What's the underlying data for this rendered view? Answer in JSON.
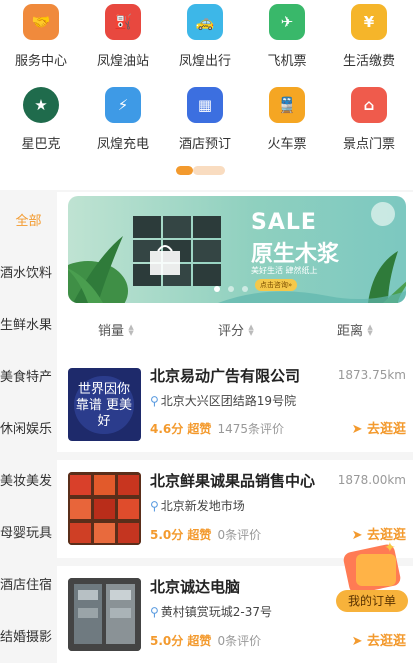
{
  "services": [
    {
      "label": "服务中心",
      "icon": "handshake-icon",
      "glyph": "🤝",
      "color": "#f08a3c"
    },
    {
      "label": "凤煌油站",
      "icon": "fuel-pump-icon",
      "glyph": "⛽",
      "color": "#e8483f"
    },
    {
      "label": "凤煌出行",
      "icon": "taxi-icon",
      "glyph": "🚕",
      "color": "#3db7e8"
    },
    {
      "label": "飞机票",
      "icon": "airplane-icon",
      "glyph": "✈",
      "color": "#39b86a"
    },
    {
      "label": "生活缴费",
      "icon": "coin-icon",
      "glyph": "¥",
      "color": "#f5b52a"
    },
    {
      "label": "星巴克",
      "icon": "starbucks-icon",
      "glyph": "★",
      "color": "#1f6b4c"
    },
    {
      "label": "凤煌充电",
      "icon": "charger-icon",
      "glyph": "⚡",
      "color": "#3e9ae6"
    },
    {
      "label": "酒店预订",
      "icon": "hotel-icon",
      "glyph": "▦",
      "color": "#3c6fe0"
    },
    {
      "label": "火车票",
      "icon": "train-icon",
      "glyph": "🚆",
      "color": "#f5a623"
    },
    {
      "label": "景点门票",
      "icon": "attraction-icon",
      "glyph": "⌂",
      "color": "#ef5b4c"
    }
  ],
  "sidebar": {
    "items": [
      "全部",
      "酒水饮料",
      "生鲜水果",
      "美食特产",
      "休闲娱乐",
      "美妆美发",
      "母婴玩具",
      "酒店住宿",
      "结婚摄影"
    ]
  },
  "banner": {
    "sale": "SALE",
    "title": "原生木浆",
    "tags": "美好生活  肆然纸上",
    "button": "点击咨询»"
  },
  "sort": {
    "sales": "销量",
    "rating": "评分",
    "distance": "距离"
  },
  "shops": [
    {
      "name": "北京易动广告有限公司",
      "distance": "1873.75km",
      "address": "北京大兴区团结路19号院",
      "score": "4.6分 超赞",
      "reviews": "1475条评价",
      "action": "去逛逛",
      "thumb_text": "世界因你 靠谱 更美好"
    },
    {
      "name": "北京鲜果诚果品销售中心",
      "distance": "1878.00km",
      "address": "北京新发地市场",
      "score": "5.0分 超赞",
      "reviews": "0条评价",
      "action": "去逛逛"
    },
    {
      "name": "北京诚达电脑",
      "distance": "",
      "address": "黄村镇赏玩城2-37号",
      "score": "5.0分 超赞",
      "reviews": "0条评价",
      "action": "去逛逛"
    }
  ],
  "floating": {
    "orders_label": "我的订单"
  },
  "colors": {
    "accent": "#f39a2e",
    "pin": "#5a9be0"
  }
}
